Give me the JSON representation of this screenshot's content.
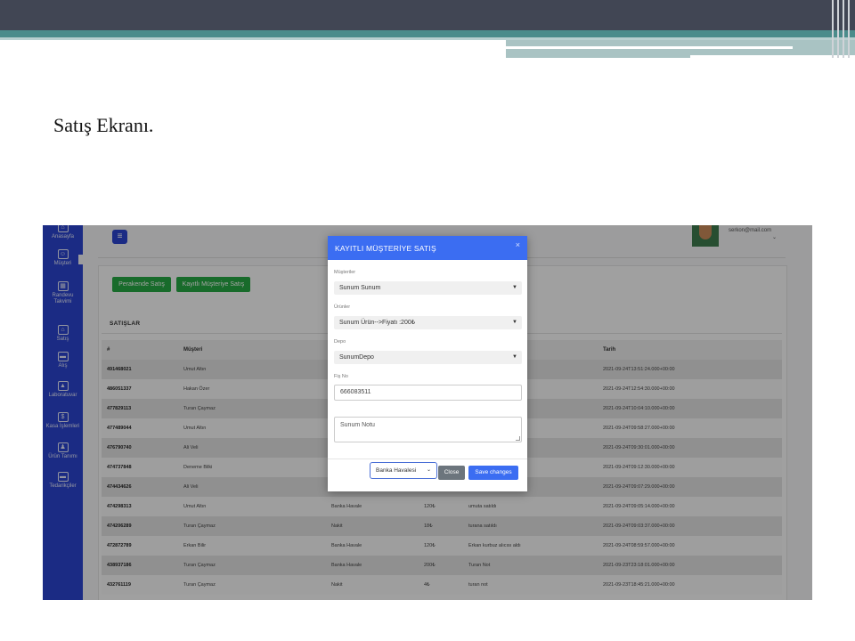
{
  "slide": {
    "title": "Satış Ekranı."
  },
  "sidebar": {
    "items": [
      {
        "label": "Anasayfa",
        "icon": "home-icon"
      },
      {
        "label": "Müşteri",
        "icon": "user-icon"
      },
      {
        "label": "Randevu Takvimi",
        "icon": "calendar-icon"
      },
      {
        "label": "Satış",
        "icon": "basket-icon"
      },
      {
        "label": "Alış",
        "icon": "truck-icon"
      },
      {
        "label": "Laboratuvar",
        "icon": "flask-icon"
      },
      {
        "label": "Kasa İşlemleri",
        "icon": "cash-icon"
      },
      {
        "label": "Ürün Tanımı",
        "icon": "people-icon"
      },
      {
        "label": "Tedarikçiler",
        "icon": "truck-icon"
      }
    ]
  },
  "header": {
    "email": "serkon@mail.com"
  },
  "buttons": {
    "retail": "Perakende Satış",
    "registered": "Kayıtlı Müşteriye Satış"
  },
  "sales": {
    "title": "SATIŞLAR",
    "columns": [
      "#",
      "Müşteri",
      "",
      "",
      "",
      "Tarih"
    ],
    "rows": [
      [
        "491468021",
        "Umut Altın",
        "",
        "",
        "",
        "2021-09-24T13:51:24.000+00:00"
      ],
      [
        "486051337",
        "Hakan Özer",
        "",
        "",
        "",
        "2021-09-24T12:54:30.000+00:00"
      ],
      [
        "477829113",
        "Turan Çaymaz",
        "",
        "",
        "",
        "2021-09-24T10:04:10.000+00:00"
      ],
      [
        "477489044",
        "Umut Altın",
        "",
        "",
        "",
        "2021-09-24T09:58:27.000+00:00"
      ],
      [
        "476790740",
        "Ali Veli",
        "",
        "",
        "",
        "2021-09-24T09:30:01.000+00:00"
      ],
      [
        "474737848",
        "Deneme Bilki",
        "",
        "",
        "",
        "2021-09-24T09:12:30.000+00:00"
      ],
      [
        "474434626",
        "Ali Veli",
        "",
        "",
        "",
        "2021-09-24T09:07:29.000+00:00"
      ],
      [
        "474298313",
        "Umut Altın",
        "Banka Havale",
        "120₺",
        "umuta satıldı",
        "2021-09-24T09:05:14.000+00:00"
      ],
      [
        "474206289",
        "Turan Çaymaz",
        "Nakit",
        "18₺",
        "turana satıldı",
        "2021-09-24T09:03:37.000+00:00"
      ],
      [
        "472872789",
        "Erkan Bilir",
        "Banka Havale",
        "120₺",
        "Erkan kurbuz alıcısı aldı",
        "2021-09-24T08:59:57.000+00:00"
      ],
      [
        "438937186",
        "Turan Çaymaz",
        "Banka Havale",
        "200₺",
        "Turan Not",
        "2021-09-23T23:18:01.000+00:00"
      ],
      [
        "432761119",
        "Turan Çaymaz",
        "Nakit",
        "4₺",
        "turan not",
        "2021-09-23T18:45:21.000+00:00"
      ]
    ]
  },
  "modal": {
    "title": "KAYITLI MÜŞTERİYE SATIŞ",
    "close_symbol": "×",
    "customer_label": "Müşteriler",
    "customer_value": "Sunum Sunum",
    "product_label": "Ürünler",
    "product_value": "Sunum Ürün-->Fiyatı :200₺",
    "depot_label": "Depo",
    "depot_value": "SunumDepo",
    "receipt_label": "Fiş No",
    "receipt_value": "666083511",
    "note_value": "Sunum Notu",
    "payment_value": "Banka Havalesi",
    "close_button": "Close",
    "save_button": "Save changes"
  },
  "colors": {
    "sidebar": "#2b44cf",
    "accent": "#3b6df2",
    "green": "#27a844",
    "slide_bar": "#414654",
    "teal": "#4b8c8b"
  }
}
